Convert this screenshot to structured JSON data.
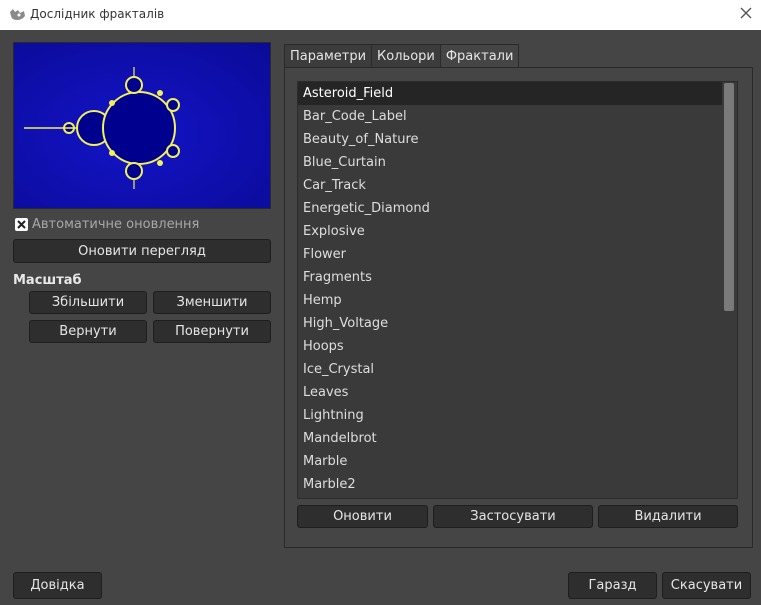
{
  "window": {
    "title": "Дослідник фракталів"
  },
  "preview": {
    "auto_update_label": "Автоматичне оновлення",
    "auto_update_checked": true,
    "refresh_label": "Оновити перегляд"
  },
  "zoom": {
    "title": "Масштаб",
    "zoom_in": "Збільшити",
    "zoom_out": "Зменшити",
    "undo": "Вернути",
    "redo": "Повернути"
  },
  "tabs": [
    {
      "label": "Параметри"
    },
    {
      "label": "Кольори"
    },
    {
      "label": "Фрактали"
    }
  ],
  "active_tab": "Фрактали",
  "fractals": [
    "Asteroid_Field",
    "Bar_Code_Label",
    "Beauty_of_Nature",
    "Blue_Curtain",
    "Car_Track",
    "Energetic_Diamond",
    "Explosive",
    "Flower",
    "Fragments",
    "Hemp",
    "High_Voltage",
    "Hoops",
    "Ice_Crystal",
    "Leaves",
    "Lightning",
    "Mandelbrot",
    "Marble",
    "Marble2"
  ],
  "selected_fractal": "Asteroid_Field",
  "list_actions": {
    "refresh": "Оновити",
    "apply": "Застосувати",
    "delete": "Видалити"
  },
  "footer": {
    "help": "Довідка",
    "ok": "Гаразд",
    "cancel": "Скасувати"
  },
  "colors": {
    "preview_background": "#0a0aa0",
    "fractal_fill": "#000090",
    "fractal_edge": "#f2f05a"
  }
}
